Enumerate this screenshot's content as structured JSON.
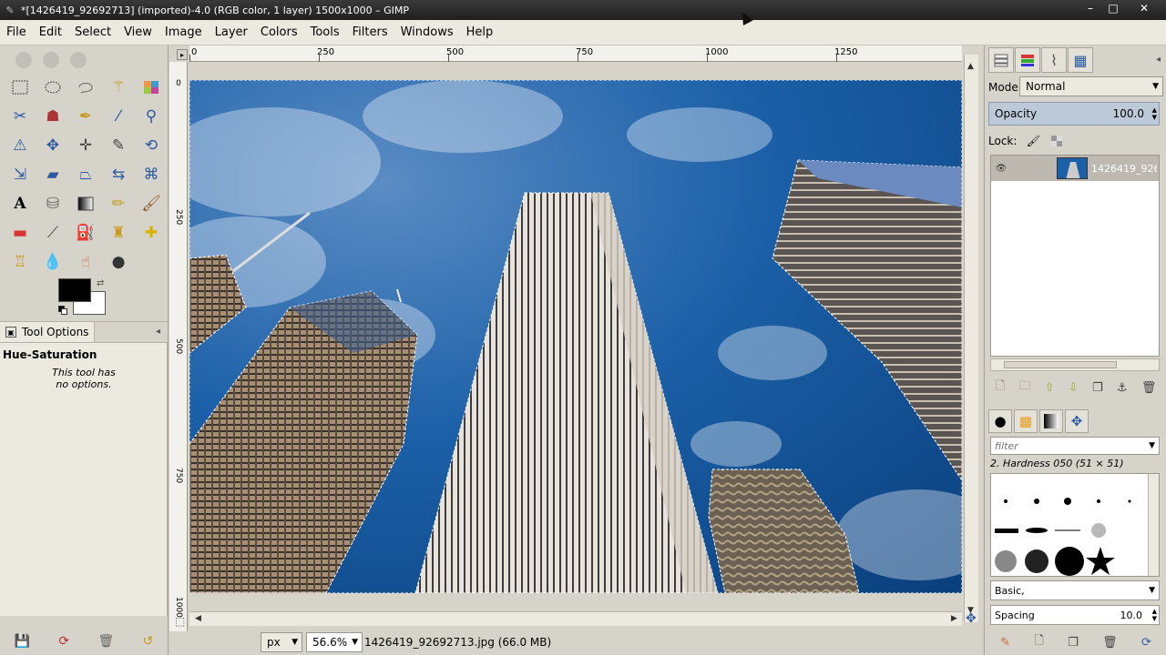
{
  "window": {
    "title": "*[1426419_92692713] (imported)-4.0 (RGB color, 1 layer) 1500x1000 – GIMP",
    "controls": [
      "–",
      "□",
      "✕"
    ]
  },
  "menu": [
    "File",
    "Edit",
    "Select",
    "View",
    "Image",
    "Layer",
    "Colors",
    "Tools",
    "Filters",
    "Windows",
    "Help"
  ],
  "toolbox": {
    "tools": [
      "rect-select-icon",
      "ellipse-select-icon",
      "free-select-icon",
      "fuzzy-select-icon",
      "select-by-color-icon",
      "scissors-icon",
      "foreground-select-icon",
      "paths-icon",
      "color-picker-icon",
      "zoom-icon",
      "measure-icon",
      "move-icon",
      "align-icon",
      "crop-icon",
      "rotate-icon",
      "scale-icon",
      "shear-icon",
      "perspective-icon",
      "flip-icon",
      "cage-icon",
      "text-icon",
      "bucket-fill-icon",
      "blend-icon",
      "pencil-icon",
      "paintbrush-icon",
      "eraser-icon",
      "airbrush-icon",
      "ink-icon",
      "clone-icon",
      "heal-icon",
      "perspective-clone-icon",
      "blur-icon",
      "smudge-icon",
      "dodge-burn-icon"
    ],
    "fg_color": "#000000",
    "bg_color": "#ffffff"
  },
  "tool_options": {
    "tab_label": "Tool Options",
    "heading": "Hue-Saturation",
    "message_line1": "This tool has",
    "message_line2": "no options."
  },
  "canvas": {
    "hruler_labels": [
      "0",
      "250",
      "500",
      "750",
      "1000",
      "1250"
    ],
    "vruler_labels": [
      "0",
      "250",
      "500",
      "750",
      "1000"
    ],
    "unit": "px",
    "zoom": "56.6%",
    "status": "1426419_92692713.jpg (66.0 MB)"
  },
  "layers": {
    "mode_label": "Mode:",
    "mode_value": "Normal",
    "opacity_label": "Opacity",
    "opacity_value": "100.0",
    "lock_label": "Lock:",
    "layer_name": "1426419_926"
  },
  "brushes": {
    "filter_placeholder": "filter",
    "brush_name": "2. Hardness 050 (51 × 51)",
    "preset": "Basic,",
    "spacing_label": "Spacing",
    "spacing_value": "10.0"
  },
  "colors": {
    "sky": "#1a5aa0",
    "selection": "#ffffff"
  }
}
